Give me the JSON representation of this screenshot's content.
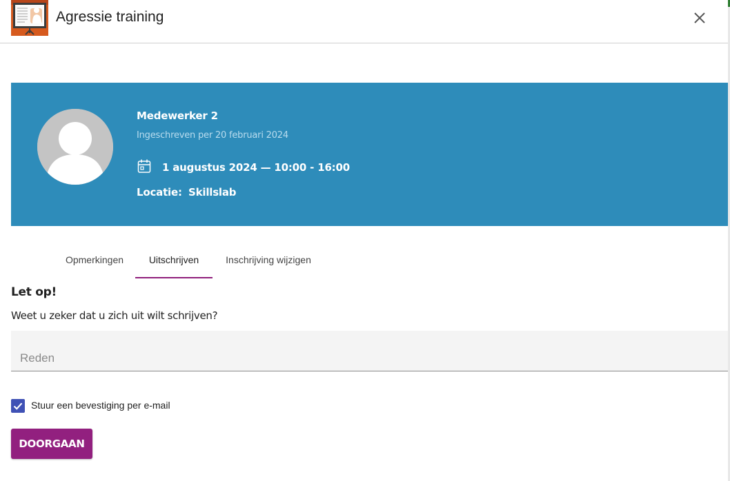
{
  "header": {
    "title": "Agressie training"
  },
  "banner": {
    "name": "Medewerker 2",
    "enrolled": "Ingeschreven per 20 februari 2024",
    "date_time": "1 augustus 2024 — 10:00 - 16:00",
    "location_label": "Locatie:",
    "location_value": "Skillslab",
    "background_color": "#2e8cba"
  },
  "tabs": [
    {
      "label": "Opmerkingen",
      "active": false
    },
    {
      "label": "Uitschrijven",
      "active": true
    },
    {
      "label": "Inschrijving wijzigen",
      "active": false
    }
  ],
  "unsubscribe": {
    "warning_title": "Let op!",
    "warning_text": "Weet u zeker dat u zich uit wilt schrijven?",
    "reason_placeholder": "Reden",
    "reason_value": "",
    "confirm_email_label": "Stuur een bevestiging per e-mail",
    "confirm_email_checked": true,
    "continue_label": "DOORGAAN"
  },
  "colors": {
    "accent": "#92207f",
    "checkbox": "#3f51b5"
  },
  "icons": {
    "logo": "presentation-board-icon",
    "close": "close-icon",
    "calendar": "calendar-icon",
    "avatar": "user-avatar-icon",
    "check": "check-icon"
  }
}
